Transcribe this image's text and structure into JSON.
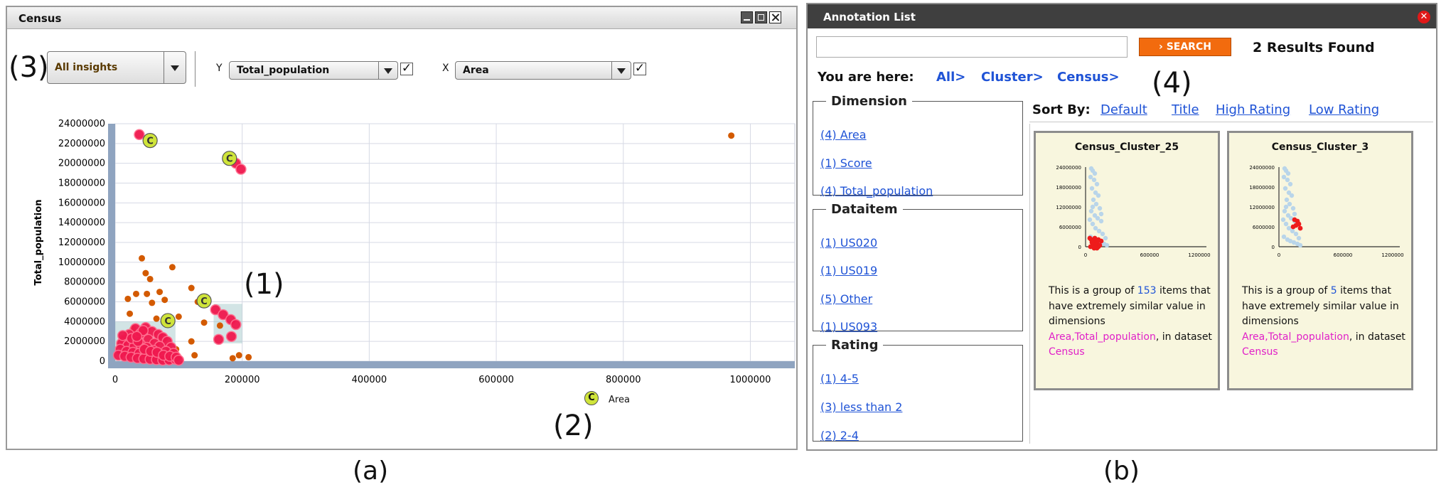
{
  "census": {
    "title": "Census",
    "insight_select": "All insights",
    "y_axis_label_prefix": "Y",
    "y_select": "Total_population",
    "x_axis_label_prefix": "X",
    "x_select": "Area",
    "y_check": "✓",
    "x_check": "✓",
    "markers": {
      "m1": "(1)",
      "m2": "(2)",
      "m3": "(3)"
    },
    "legend_area_label": "Area",
    "legend_glyph": "C"
  },
  "chart_data": {
    "type": "scatter",
    "xlabel": "",
    "ylabel": "Total_population",
    "xlim": [
      0,
      1070000
    ],
    "ylim": [
      0,
      24000000
    ],
    "x_ticks": [
      "0",
      "200000",
      "400000",
      "600000",
      "800000",
      "1000000"
    ],
    "y_ticks": [
      "0",
      "2000000",
      "4000000",
      "6000000",
      "8000000",
      "10000000",
      "12000000",
      "14000000",
      "16000000",
      "18000000",
      "20000000",
      "22000000",
      "24000000"
    ],
    "grid": true,
    "series": [
      {
        "color": "#d35a00",
        "points": [
          [
            970000,
            22800000
          ],
          [
            42000,
            10400000
          ],
          [
            90000,
            9500000
          ],
          [
            48000,
            8900000
          ],
          [
            55000,
            8300000
          ],
          [
            120000,
            7400000
          ],
          [
            33000,
            6800000
          ],
          [
            70000,
            7000000
          ],
          [
            50000,
            6800000
          ],
          [
            20000,
            6300000
          ],
          [
            58000,
            5900000
          ],
          [
            78000,
            6200000
          ],
          [
            130000,
            6000000
          ],
          [
            23000,
            4800000
          ],
          [
            100000,
            4500000
          ],
          [
            65000,
            4300000
          ],
          [
            88000,
            4000000
          ],
          [
            140000,
            3900000
          ],
          [
            165000,
            3600000
          ],
          [
            120000,
            2000000
          ],
          [
            96000,
            1200000
          ],
          [
            125000,
            600000
          ],
          [
            185000,
            300000
          ],
          [
            195000,
            600000
          ],
          [
            210000,
            400000
          ],
          [
            28000,
            3300000
          ]
        ]
      },
      {
        "color": "#f0184e",
        "points": [
          [
            38000,
            22900000
          ],
          [
            190000,
            20000000
          ],
          [
            198000,
            19400000
          ],
          [
            158000,
            5200000
          ],
          [
            170000,
            4700000
          ],
          [
            182000,
            4200000
          ],
          [
            190000,
            3700000
          ],
          [
            163000,
            2200000
          ],
          [
            183000,
            2500000
          ],
          [
            32000,
            3300000
          ],
          [
            48000,
            3400000
          ],
          [
            58000,
            3000000
          ],
          [
            68000,
            2700000
          ],
          [
            75000,
            2400000
          ],
          [
            82000,
            2000000
          ],
          [
            88000,
            1400000
          ],
          [
            40000,
            2800000
          ],
          [
            22000,
            2700000
          ],
          [
            15000,
            2200000
          ],
          [
            52000,
            2200000
          ],
          [
            62000,
            1800000
          ],
          [
            70000,
            1500000
          ],
          [
            80000,
            1000000
          ],
          [
            92000,
            800000
          ],
          [
            10000,
            1800000
          ],
          [
            20000,
            1600000
          ],
          [
            30000,
            1500000
          ],
          [
            40000,
            1700000
          ],
          [
            50000,
            1400000
          ],
          [
            60000,
            1100000
          ],
          [
            70000,
            700000
          ],
          [
            8000,
            1200000
          ],
          [
            18000,
            1000000
          ],
          [
            28000,
            900000
          ],
          [
            38000,
            800000
          ],
          [
            48000,
            700000
          ],
          [
            58000,
            600000
          ],
          [
            68000,
            400000
          ],
          [
            78000,
            300000
          ],
          [
            88000,
            300000
          ],
          [
            5000,
            600000
          ],
          [
            15000,
            500000
          ],
          [
            25000,
            400000
          ],
          [
            35000,
            300000
          ],
          [
            45000,
            250000
          ],
          [
            55000,
            200000
          ],
          [
            65000,
            150000
          ],
          [
            75000,
            100000
          ],
          [
            85000,
            120000
          ],
          [
            95000,
            200000
          ],
          [
            12000,
            2600000
          ],
          [
            26000,
            2300000
          ],
          [
            36000,
            2000000
          ],
          [
            46000,
            1200000
          ],
          [
            56000,
            1000000
          ],
          [
            66000,
            900000
          ],
          [
            76000,
            600000
          ],
          [
            86000,
            500000
          ],
          [
            96000,
            400000
          ],
          [
            100000,
            100000
          ],
          [
            44000,
            3100000
          ],
          [
            34000,
            2500000
          ]
        ]
      },
      {
        "color": "#cfe43a",
        "points": [
          [
            55000,
            22300000
          ],
          [
            180000,
            20500000
          ],
          [
            140000,
            6100000
          ],
          [
            83000,
            4100000
          ]
        ]
      }
    ]
  },
  "annotation": {
    "title": "Annotation List",
    "close": "✕",
    "search_value": "",
    "search_button": "SEARCH",
    "results": "2 Results Found",
    "you_are_here": "You are here:",
    "breadcrumb": [
      "All>",
      "Cluster>",
      "Census>"
    ],
    "sort_by": "Sort By:",
    "sort_options": [
      "Default",
      "Title",
      "High Rating",
      "Low Rating"
    ],
    "marker4": "(4)",
    "facets": {
      "dimension": {
        "title": "Dimension",
        "items": [
          "(4) Area",
          "(1) Score",
          "(4) Total_population"
        ]
      },
      "dataitem": {
        "title": "Dataitem",
        "items": [
          "(1) US020",
          "(1) US019",
          "(5) Other",
          "(1) US093"
        ]
      },
      "rating": {
        "title": "Rating",
        "items": [
          "(1) 4-5",
          "(3) less than 2",
          "(2) 2-4"
        ]
      }
    },
    "cards": [
      {
        "title": "Census_Cluster_25",
        "desc_a": "This is a group of ",
        "count": "153",
        "desc_b": " items that have extremely similar value in dimensions ",
        "dims": "Area,Total_population",
        "desc_c": ", in dataset ",
        "dataset": "Census",
        "thumb_y_ticks": [
          "24000000",
          "18000000",
          "12000000",
          "6000000",
          "0"
        ],
        "thumb_x_ticks": [
          "0",
          "600000",
          "1200000"
        ]
      },
      {
        "title": "Census_Cluster_3",
        "desc_a": "This is a group of ",
        "count": "5",
        "desc_b": " items that have extremely similar value in dimensions ",
        "dims": "Area,Total_population",
        "desc_c": ", in dataset ",
        "dataset": "Census",
        "thumb_y_ticks": [
          "24000000",
          "18000000",
          "12000000",
          "6000000",
          "0"
        ],
        "thumb_x_ticks": [
          "0",
          "600000",
          "1200000"
        ]
      }
    ]
  },
  "captions": {
    "a": "(a)",
    "b": "(b)"
  }
}
